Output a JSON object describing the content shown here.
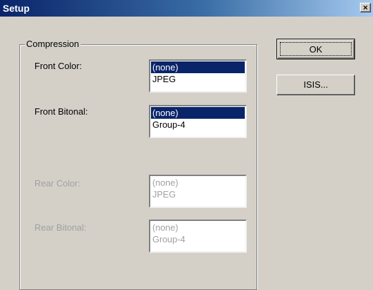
{
  "window": {
    "title": "Setup",
    "close_glyph": "×"
  },
  "compression": {
    "legend": "Compression",
    "front_color": {
      "label": "Front Color:",
      "options": [
        "(none)",
        "JPEG"
      ],
      "selected": "(none)"
    },
    "front_bitonal": {
      "label": "Front Bitonal:",
      "options": [
        "(none)",
        "Group-4"
      ],
      "selected": "(none)"
    },
    "rear_color": {
      "label": "Rear Color:",
      "options": [
        "(none)",
        "JPEG"
      ]
    },
    "rear_bitonal": {
      "label": "Rear Bitonal:",
      "options": [
        "(none)",
        "Group-4"
      ]
    }
  },
  "buttons": {
    "ok_label": "OK",
    "isis_label": "ISIS..."
  },
  "colors": {
    "selection": "#0a246a",
    "disabled_text": "#a0a0a0",
    "dialog_bg": "#d4d0c8"
  }
}
